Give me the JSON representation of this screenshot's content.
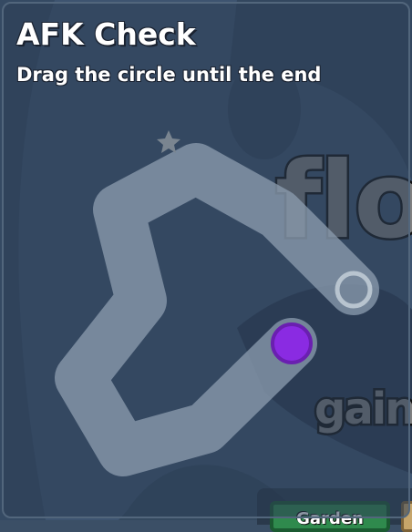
{
  "dialog": {
    "title": "AFK Check",
    "subtitle": "Drag the circle until the end"
  },
  "background": {
    "title_fragment": "flo",
    "subtitle_fragment": "gain"
  },
  "bottom_bar": {
    "garden_label": "Garden"
  },
  "drag_handle": {
    "color": "#8a2be2"
  },
  "target_ring": {
    "color": "#b8c4cf"
  }
}
